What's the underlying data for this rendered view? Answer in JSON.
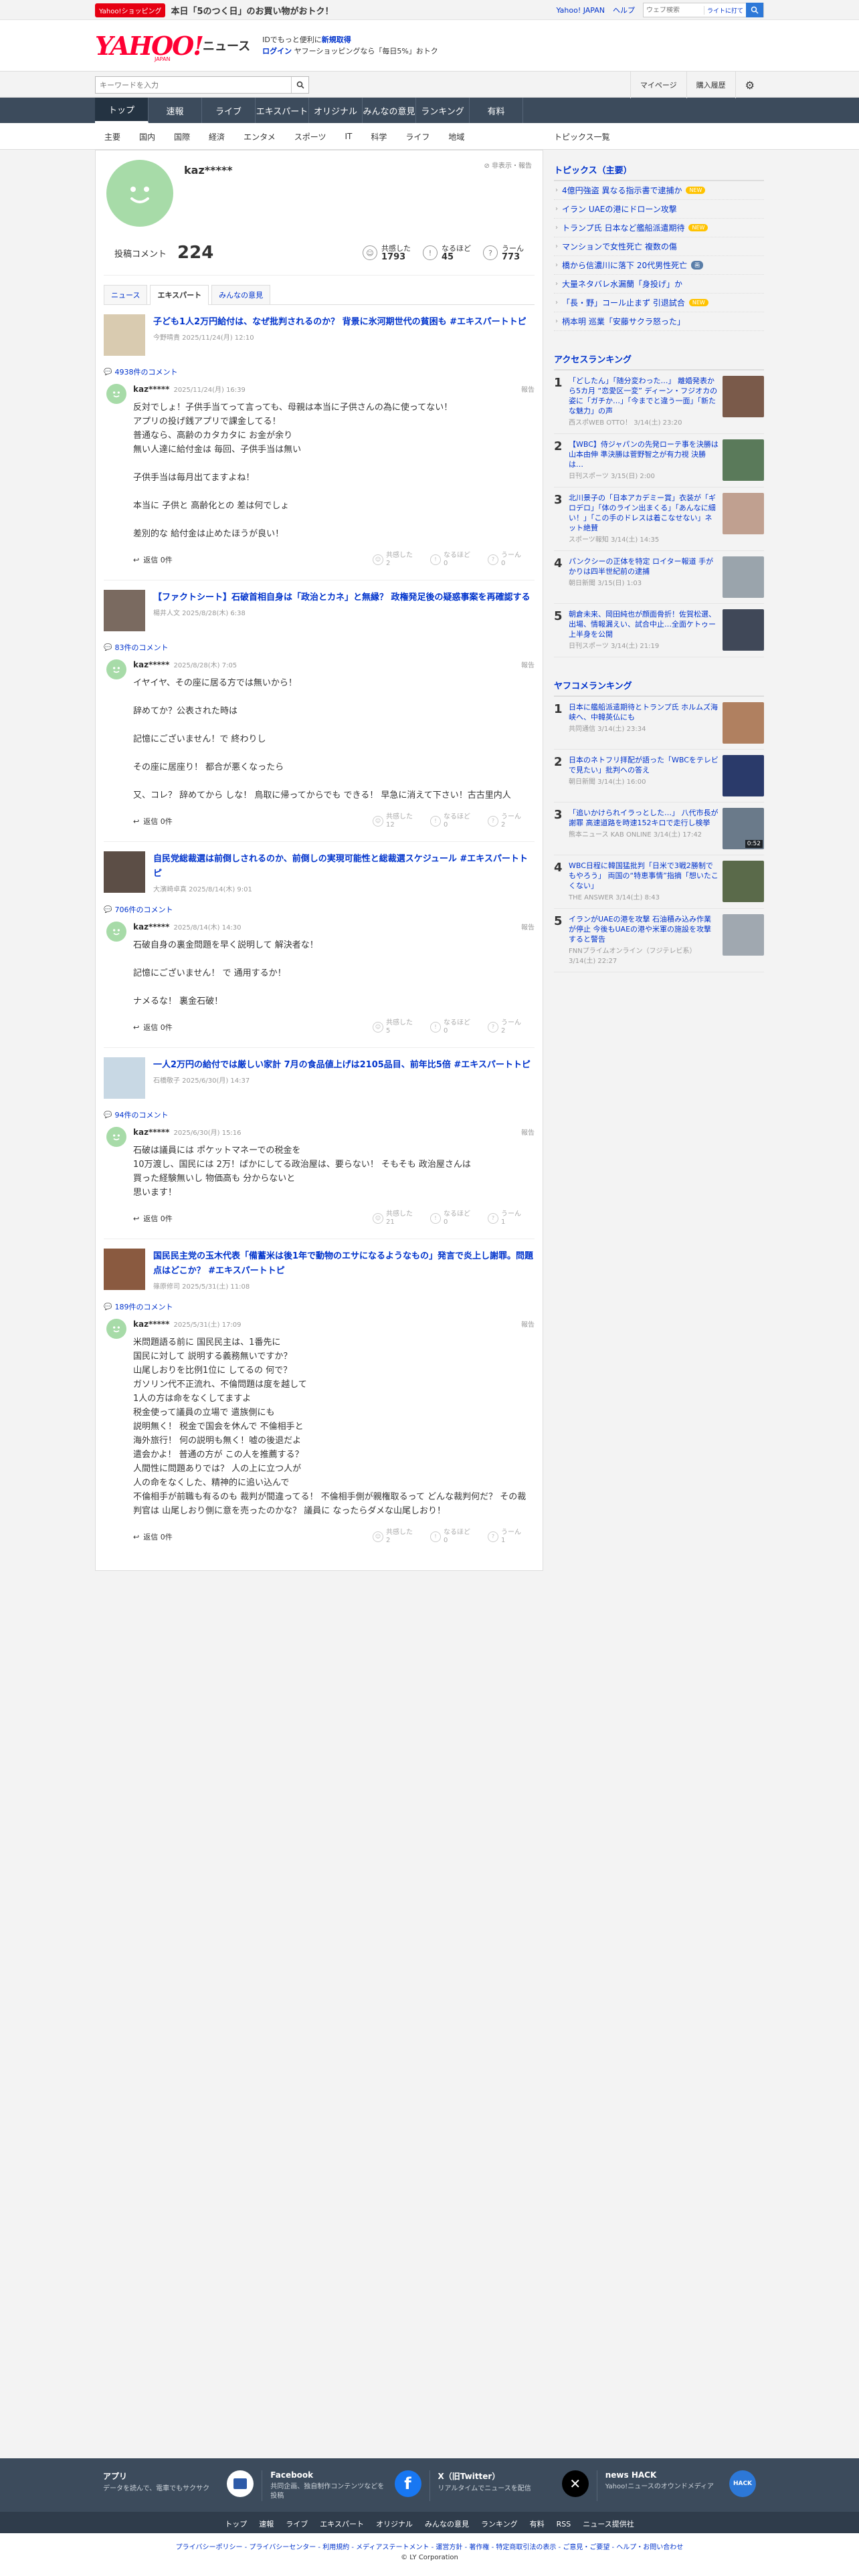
{
  "topbar": {
    "badge": "Yahoo!ショッピング",
    "promo": "本日「5のつく日」のお買い物がおトク！",
    "links": [
      "Yahoo! JAPAN",
      "ヘルプ"
    ],
    "search_placeholder": "ウェブ検索",
    "search_hint": "ライトに打て"
  },
  "header": {
    "logo": "YAHOO!",
    "logo_sub": "JAPAN",
    "section": "ニュース",
    "promo_line1_prefix": "IDでもっと便利に",
    "promo_line1_link": "新規取得",
    "promo_line2_login": "ログイン",
    "promo_line2_text": "ヤフーショッピングなら「毎日5%」おトク"
  },
  "searchrow": {
    "placeholder": "キーワードを入力",
    "buttons": [
      "マイページ",
      "購入履歴"
    ]
  },
  "gnav": [
    "トップ",
    "速報",
    "ライブ",
    "エキスパート",
    "オリジナル",
    "みんなの意見",
    "ランキング",
    "有料"
  ],
  "snav": {
    "items": [
      "主要",
      "国内",
      "国際",
      "経済",
      "エンタメ",
      "スポーツ",
      "IT",
      "科学",
      "ライフ",
      "地域"
    ],
    "right": "トピックス一覧"
  },
  "profile": {
    "name": "kaz*****",
    "settings": "非表示・報告",
    "comments_label": "投稿コメント",
    "comments_count": "224",
    "reactions": [
      {
        "label": "共感した",
        "value": "1793",
        "icon": "smile-icon"
      },
      {
        "label": "なるほど",
        "value": "45",
        "icon": "lightbulb-icon"
      },
      {
        "label": "うーん",
        "value": "773",
        "icon": "thinking-icon"
      }
    ]
  },
  "tabs": [
    "ニュース",
    "エキスパート",
    "みんなの意見"
  ],
  "comment_reaction_labels": [
    "共感した",
    "なるほど",
    "うーん"
  ],
  "reply_label": "返信 0件",
  "report_label": "報告",
  "articles": [
    {
      "title": "子ども1人2万円給付は、なぜ批判されるのか？ 背景に氷河期世代の貧困も #エキスパートトピ",
      "meta": "今野晴貴 2025/11/24(月) 12:10",
      "comment_count": "4938件のコメント",
      "user": "kaz*****",
      "date": "2025/11/24(月) 16:39",
      "text": "反対でしょ！子供手当てって言っても、母親は本当に子供さんの為に使ってない！\nアプリの投げ銭アプリで課金してる！\n普通なら、高齢のカタカタに お金が余り\n無い人達に給付金は 毎回、子供手当は無い\n\n子供手当は毎月出てますよね！\n\n本当に 子供と 高齢化との 差は何でしょ\n\n差別的な 給付金は止めたほうが良い！",
      "reacts": [
        "2",
        "0",
        "0"
      ],
      "thumb": "#d9cbb0"
    },
    {
      "title": "【ファクトシート】石破首相自身は「政治とカネ」と無縁？ 政権発足後の疑惑事案を再確認する",
      "meta": "楊井人文 2025/8/28(木) 6:38",
      "comment_count": "83件のコメント",
      "user": "kaz*****",
      "date": "2025/8/28(木) 7:05",
      "text": "イヤイヤ、その座に居る方では無いから！\n\n辞めてか？公表された時は\n\n記憶にございません！で 終わりし\n\nその座に居座り！ 都合が悪くなったら\n\n又、コレ？ 辞めてから しな！ 鳥取に帰ってからでも できる！ 早急に消えて下さい！古古里内人",
      "reacts": [
        "12",
        "0",
        "2"
      ],
      "thumb": "#7a6a60"
    },
    {
      "title": "自民党総裁選は前倒しされるのか、前倒しの実現可能性と総裁選スケジュール #エキスパートトピ",
      "meta": "大濱崎卓真 2025/8/14(木) 9:01",
      "comment_count": "706件のコメント",
      "user": "kaz*****",
      "date": "2025/8/14(木) 14:30",
      "text": "石破自身の裏金問題を早く説明して 解決者な！\n\n記憶にございません！ で 通用するか！\n\nナメるな！ 裏金石破！",
      "reacts": [
        "5",
        "0",
        "2"
      ],
      "thumb": "#5c4e46"
    },
    {
      "title": "一人2万円の給付では厳しい家計 7月の食品値上げは2105品目、前年比5倍 #エキスパートトピ",
      "meta": "石橋敬子 2025/6/30(月) 14:37",
      "comment_count": "94件のコメント",
      "user": "kaz*****",
      "date": "2025/6/30(月) 15:16",
      "text": "石破は議員には ポケットマネーでの税金を\n10万渡し、国民には 2万！ばかにしてる政治屋は、要らない！ そもそも 政治屋さんは\n買った経験無いし 物価高も 分からないと\n思います！",
      "reacts": [
        "21",
        "0",
        "1"
      ],
      "thumb": "#c8d8e4"
    },
    {
      "title": "国民民主党の玉木代表「備蓄米は後1年で動物のエサになるようなもの」発言で炎上し謝罪。問題点はどこか？ #エキスパートトピ",
      "meta": "篠原修司 2025/5/31(土) 11:08",
      "comment_count": "189件のコメント",
      "user": "kaz*****",
      "date": "2025/5/31(土) 17:09",
      "text": "米問題語る前に 国民民主は、1番先に\n国民に対して 説明する義務無いですか？\n山尾しおりを比例1位に してるの 何で？\nガソリン代不正流れ、不倫問題は度を越して\n1人の方は命をなくしてますよ\n税金使って議員の立場で 遣族側にも\n説明無く！ 税金で国会を休んで 不倫相手と\n海外旅行！ 何の説明も無く！嘘の後退だよ\n遣会かよ！ 普通の方が この人を推薦する？\n人間性に問題ありでは？ 人の上に立つ人が\n人の命をなくした、精神的に追い込んで\n不倫相手が前職も有るのも 裁判が間違ってる！ 不倫相手側が親権取るって どんな裁判何だ？ その裁判官は 山尾しおり側に意を売ったのかな？ 議員に なったらダメな山尾しおり！",
      "reacts": [
        "2",
        "0",
        "1"
      ],
      "thumb": "#8a5a40"
    }
  ],
  "topics": {
    "heading": "トピックス（主要）",
    "items": [
      {
        "text": "4億円強盗 異なる指示書で逮捕か",
        "tag": "NEW",
        "tagtype": "new"
      },
      {
        "text": "イラン UAEの港にドローン攻撃",
        "tag": "",
        "tagtype": ""
      },
      {
        "text": "トランプ氏 日本など艦船派遣期待",
        "tag": "NEW",
        "tagtype": "new"
      },
      {
        "text": "マンションで女性死亡 複数の傷",
        "tag": "",
        "tagtype": ""
      },
      {
        "text": "橋から信濃川に落下 20代男性死亡",
        "tag": "画",
        "tagtype": "img"
      },
      {
        "text": "大量ネタバレ水漏蘭「身投げ」か",
        "tag": "",
        "tagtype": ""
      },
      {
        "text": "「長・野」コール止まず 引退試合",
        "tag": "NEW",
        "tagtype": "new"
      },
      {
        "text": "柄本明 巡業「安藤サクラ怒った」",
        "tag": "",
        "tagtype": ""
      }
    ]
  },
  "access_ranking": {
    "heading": "アクセスランキング",
    "items": [
      {
        "n": "1",
        "text": "「どしたん」「随分変わった…」 離婚発表から5カ月 “恋愛区一変” ディーン・フジオカの姿に「ガチか…」「今までと違う一面」「新たな魅力」の声",
        "src": "西スポWEB OTTO！ 3/14(土) 23:20",
        "thumb": "#7a5a4a"
      },
      {
        "n": "2",
        "text": "【WBC】侍ジャパンの先発ローテ事を決勝は山本由伸 準決勝は菅野智之が有力視 決勝は…",
        "src": "日刊スポーツ 3/15(日) 2:00",
        "thumb": "#5a7a5a"
      },
      {
        "n": "3",
        "text": "北川景子の「日本アカデミー賞」衣装が「ギロデロ」「体のライン出まくる」「あんなに細い！」「この手のドレスは着こなせない」ネット絶賛",
        "src": "スポーツ報知 3/14(土) 14:35",
        "thumb": "#c0a090"
      },
      {
        "n": "4",
        "text": "パンクシーの正体を特定 ロイター報道 手がかりは四半世紀前の逮捕",
        "src": "朝日新聞 3/15(日) 1:03",
        "thumb": "#9aa4ac"
      },
      {
        "n": "5",
        "text": "朝倉未来、岡田純也が顔面骨折！佐賀松選、出場、情報漏えい、試合中止…全面ケトゥー上半身を公開",
        "src": "日刊スポーツ 3/14(土) 21:19",
        "thumb": "#404858"
      }
    ]
  },
  "yahoo_ranking": {
    "heading": "ヤフコメランキング",
    "items": [
      {
        "n": "1",
        "text": "日本に艦船派遣期待とトランプ氏 ホルムズ海峡へ、中韓英仏にも",
        "src": "共同通信 3/14(土) 23:34",
        "thumb": "#b08060"
      },
      {
        "n": "2",
        "text": "日本のネトフリ拝配が語った「WBCをテレビで見たい」批判への答え",
        "src": "朝日新聞 3/14(土) 16:00",
        "thumb": "#2a3a6a"
      },
      {
        "n": "3",
        "text": "「追いかけられイラっとした…」 八代市長が謝罪 高速道路を時速152キロで走行し検挙",
        "src": "熊本ニュース KAB ONLINE 3/14(土) 17:42",
        "thumb": "#6a7a8a",
        "badge": "0:52"
      },
      {
        "n": "4",
        "text": "WBC日程に韓国猛批判「日米で3戦2勝制でもやろう」 両国の“特恵事情”指摘「想いたこくない」",
        "src": "THE ANSWER 3/14(土) 8:43",
        "thumb": "#5a6a4a"
      },
      {
        "n": "5",
        "text": "イランがUAEの港を攻撃 石油積み込み作業が停止 今後もUAEの港や米軍の施設を攻撃すると警告",
        "src": "FNNプライムオンライン（フジテレビ系） 3/14(土) 22:27",
        "thumb": "#a0a8b0"
      }
    ]
  },
  "footer": {
    "cols": [
      {
        "title": "アプリ",
        "desc": "データを読んで、電車でもサクサク",
        "icon": "app-icon"
      },
      {
        "title": "Facebook",
        "desc": "共同企画、独自制作コンテンツなどを投稿",
        "icon": "facebook-icon"
      },
      {
        "title": "X（旧Twitter）",
        "desc": "リアルタイムでニュースを配信",
        "icon": "x-icon"
      },
      {
        "title": "news HACK",
        "desc": "Yahoo!ニュースのオウンドメディア",
        "icon": "newshack-icon"
      }
    ],
    "nav": [
      "トップ",
      "速報",
      "ライブ",
      "エキスパート",
      "オリジナル",
      "みんなの意見",
      "ランキング",
      "有料",
      "RSS",
      "ニュース提供社"
    ],
    "legal": "プライバシーポリシー - プライバシーセンター - 利用規約 - メディアステートメント - 運営方針 - 著作権 - 特定商取引法の表示 - ご意見・ご要望 - ヘルプ・お問い合わせ",
    "copyright": "© LY Corporation"
  },
  "colors": {
    "brand": "#ff0033",
    "link": "#0033cc",
    "nav": "#3c4b5c",
    "avatar": "#a7dba8"
  }
}
